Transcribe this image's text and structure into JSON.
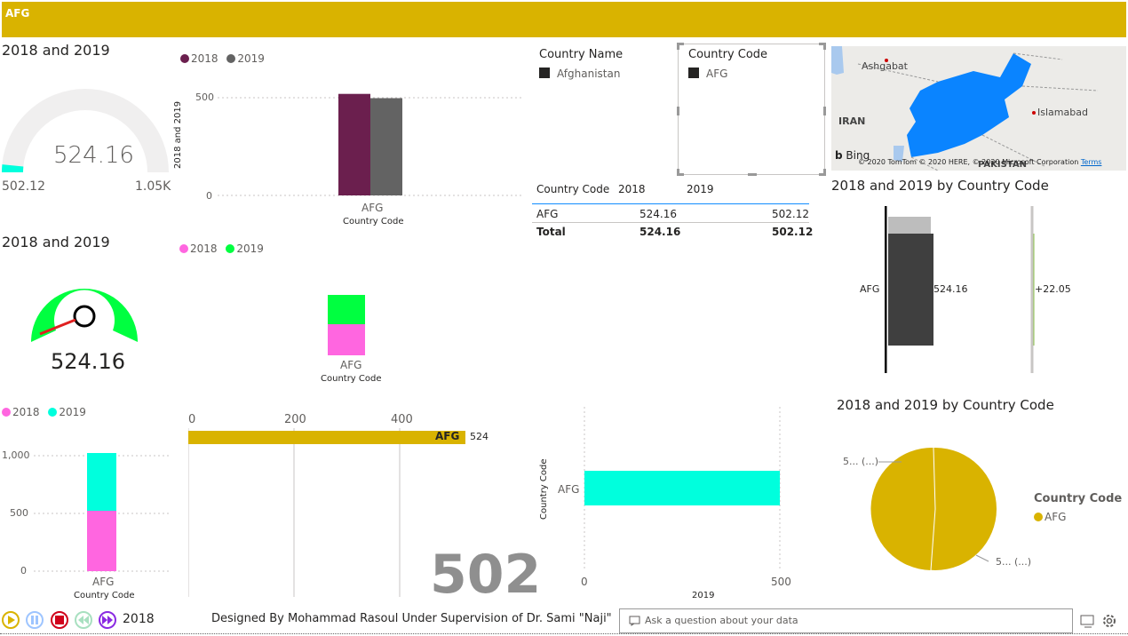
{
  "banner": {
    "label": "AFG",
    "color": "#d9b300"
  },
  "gauge1": {
    "title": "2018 and 2019",
    "value": "524.16",
    "min": "502.12",
    "max": "1.05K",
    "fill_fraction": 0.03
  },
  "column1": {
    "legend": [
      "2018",
      "2019"
    ],
    "ylabel": "2018 and 2019",
    "ticks": [
      "500",
      "0"
    ],
    "category": "AFG",
    "xlabel": "Country Code"
  },
  "slicer_country_name": {
    "title": "Country Name",
    "item": "Afghanistan"
  },
  "slicer_country_code": {
    "title": "Country Code",
    "item": "AFG"
  },
  "map": {
    "labels": {
      "ashgabat": "Ashgabat",
      "iran": "IRAN",
      "islamabad": "Islamabad",
      "pakistan": "PAKISTAN"
    },
    "brand": "Bing",
    "copyright": "© 2020 TomTom © 2020 HERE, © 2020 Microsoft Corporation",
    "terms": "Terms"
  },
  "table": {
    "headers": [
      "Country Code",
      "2018",
      "2019"
    ],
    "rows": [
      [
        "AFG",
        "524.16",
        "502.12"
      ]
    ],
    "total": [
      "Total",
      "524.16",
      "502.12"
    ]
  },
  "waterfall": {
    "title": "2018 and 2019 by Country Code",
    "category": "AFG",
    "value_label": "524.16",
    "delta_label": "+22.05"
  },
  "gauge2": {
    "title": "2018 and 2019",
    "value": "524.16"
  },
  "stacked1": {
    "legend": [
      "2018",
      "2019"
    ],
    "category": "AFG",
    "xlabel": "Country Code"
  },
  "stacked2": {
    "legend": [
      "2018",
      "2019"
    ],
    "ticks": [
      "1,000",
      "500",
      "0"
    ],
    "category": "AFG",
    "xlabel": "Country Code"
  },
  "bar1": {
    "ticks": [
      "0",
      "200",
      "400"
    ],
    "category": "AFG",
    "value_label": "524"
  },
  "card": {
    "value": "502"
  },
  "bar2": {
    "ylabel": "Country Code",
    "category": "AFG",
    "ticks": [
      "0",
      "500"
    ],
    "xlabel": "2019"
  },
  "pie": {
    "title": "2018 and 2019 by Country Code",
    "label_top": "5... (...)",
    "label_bottom": "5... (...)",
    "legend_title": "Country Code",
    "legend_item": "AFG"
  },
  "play_axis": {
    "year": "2018"
  },
  "footer": {
    "credit": "Designed By Mohammad Rasoul Under Supervision of Dr. Sami \"Naji\""
  },
  "qa": {
    "placeholder": "Ask a question about your data"
  },
  "chart_data": [
    {
      "type": "bar",
      "categories": [
        "AFG"
      ],
      "series": [
        {
          "name": "2018",
          "values": [
            524.16
          ]
        },
        {
          "name": "2019",
          "values": [
            502.12
          ]
        }
      ],
      "ylabel": "2018 and 2019",
      "xlabel": "Country Code"
    },
    {
      "type": "bar",
      "categories": [
        "AFG"
      ],
      "series": [
        {
          "name": "2018",
          "values": [
            524.16
          ]
        },
        {
          "name": "2019",
          "values": [
            502.12
          ]
        }
      ],
      "ylabel": "",
      "xlabel": "Country Code",
      "ylim": [
        0,
        1050
      ]
    },
    {
      "type": "bar",
      "categories": [
        "AFG"
      ],
      "values": [
        524
      ]
    },
    {
      "type": "bar",
      "categories": [
        "AFG"
      ],
      "values": [
        502.12
      ],
      "xlabel": "2019",
      "ylabel": "Country Code"
    },
    {
      "type": "pie",
      "title": "2018 and 2019 by Country Code",
      "categories": [
        "2018",
        "2019"
      ],
      "values": [
        524.16,
        502.12
      ]
    }
  ],
  "colors": {
    "maroon": "#6b1f4e",
    "grey": "#636363",
    "pink": "#ff66e0",
    "green": "#00ff40",
    "cyan": "#00ffdd",
    "gold": "#d9b300",
    "map_blue": "#0a84ff"
  }
}
